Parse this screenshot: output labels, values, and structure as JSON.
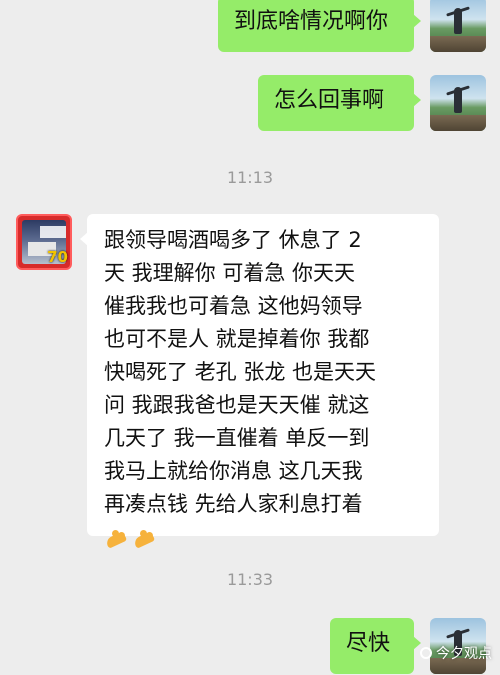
{
  "messages": [
    {
      "sender": "self",
      "text": "到底啥情况啊你"
    },
    {
      "sender": "self",
      "text": "怎么回事啊"
    },
    {
      "type": "time",
      "text": "11:13"
    },
    {
      "sender": "other",
      "lines": [
        "跟领导喝酒喝多了  休息了 2",
        "天  我理解你 可着急  你天天",
        "催我我也可着急  这他妈领导",
        "也可不是人  就是掉着你  我都",
        "快喝死了  老孔 张龙 也是天天",
        "问  我跟我爸也是天天催  就这",
        "几天了  我一直催着  单反一到",
        "  我马上就给你消息  这几天我",
        "再凑点钱  先给人家利息打着"
      ],
      "emoji": [
        "clapping-hands-emoji",
        "clapping-hands-emoji"
      ],
      "avatar_badge": "70"
    },
    {
      "type": "time",
      "text": "11:33"
    },
    {
      "sender": "self",
      "text": "尽快"
    }
  ],
  "watermark": "今夕观点",
  "colors": {
    "background": "#ededed",
    "self_bubble": "#95ec69",
    "other_bubble": "#ffffff",
    "timestamp": "#9a9a9a"
  }
}
